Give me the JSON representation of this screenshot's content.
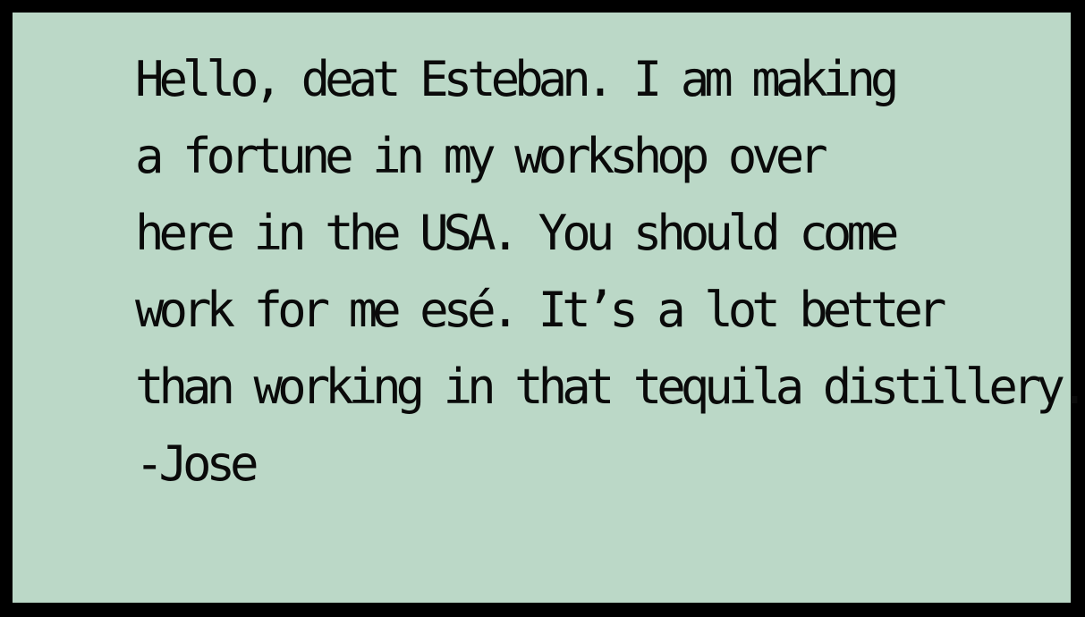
{
  "colors": {
    "frame": "#000000",
    "panel": "#bbd8c7",
    "text": "#0a0a0a"
  },
  "letter": {
    "lines": [
      "Hello, deat Esteban. I am making",
      "a fortune in my workshop over",
      "here in the USA. You should come",
      "work for me esé. It’s a lot better",
      "than working in that tequila distillery.",
      "-Jose"
    ]
  }
}
